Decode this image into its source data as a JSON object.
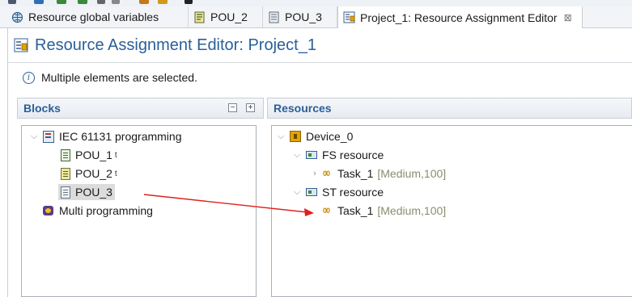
{
  "tabs": [
    {
      "label": "Resource global variables",
      "icon": "globe-icon",
      "active": false
    },
    {
      "label": "POU_2",
      "icon": "pou-icon",
      "active": false
    },
    {
      "label": "POU_3",
      "icon": "document-icon",
      "active": false
    },
    {
      "label": "Project_1: Resource Assignment Editor",
      "icon": "resource-editor-icon",
      "active": true,
      "close": "⊠"
    }
  ],
  "editor": {
    "title": "Resource Assignment Editor: Project_1",
    "info_message": "Multiple elements are selected."
  },
  "blocks": {
    "header": "Blocks",
    "collapse_label": "−",
    "expand_label": "+",
    "tree": {
      "root_label": "IEC 61131 programming",
      "pou1_label": "POU_1",
      "pou1_suffix": "t",
      "pou2_label": "POU_2",
      "pou2_suffix": "t",
      "pou3_label": "POU_3",
      "multi_label": "Multi programming"
    }
  },
  "resources": {
    "header": "Resources",
    "tree": {
      "device_label": "Device_0",
      "fs_label": "FS resource",
      "fs_task_label": "Task_1",
      "fs_task_meta": "[Medium,100]",
      "st_label": "ST resource",
      "st_task_label": "Task_1",
      "st_task_meta": "[Medium,100]"
    }
  },
  "colors": {
    "title_blue": "#2a5f9a",
    "arrow_red": "#e02020",
    "selection_gray": "#dcdcdc"
  }
}
